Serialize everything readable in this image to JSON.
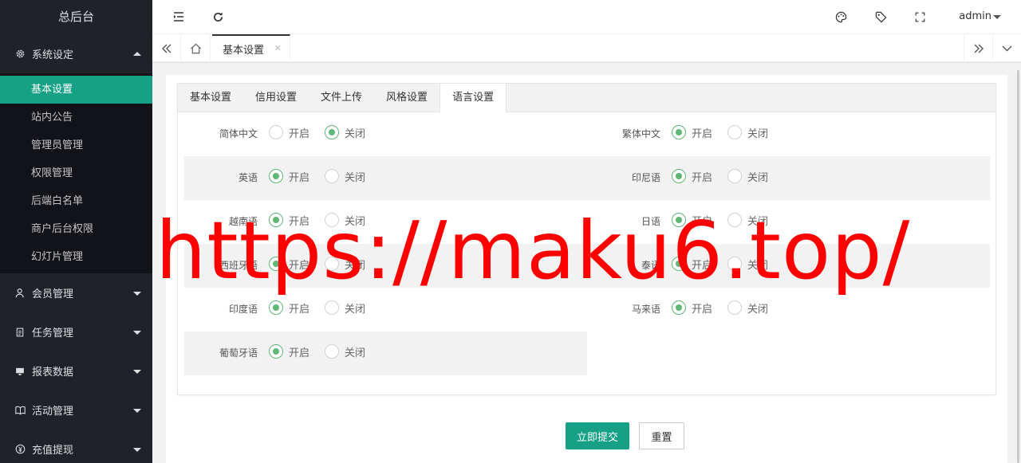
{
  "sidebar": {
    "logo": "总后台",
    "groups": [
      {
        "label": "系统设定",
        "icon": "gear-icon",
        "expanded": true,
        "items": [
          "基本设置",
          "站内公告",
          "管理员管理",
          "权限管理",
          "后端白名单",
          "商户后台权限",
          "幻灯片管理"
        ],
        "active_item": "基本设置"
      },
      {
        "label": "会员管理",
        "icon": "users-icon"
      },
      {
        "label": "任务管理",
        "icon": "document-icon"
      },
      {
        "label": "报表数据",
        "icon": "monitor-icon"
      },
      {
        "label": "活动管理",
        "icon": "book-icon"
      },
      {
        "label": "充值提现",
        "icon": "yen-icon"
      }
    ]
  },
  "header": {
    "icons": [
      "menu-fold-icon",
      "refresh-icon",
      "palette-icon",
      "tag-icon",
      "fullscreen-icon"
    ],
    "user": "admin"
  },
  "tabbar": {
    "current_tab": "基本设置"
  },
  "settings": {
    "tabs": [
      "基本设置",
      "信用设置",
      "文件上传",
      "风格设置",
      "语言设置"
    ],
    "active_tab": "语言设置",
    "on_label": "开启",
    "off_label": "关闭",
    "rows": [
      [
        {
          "label": "简体中文",
          "enabled": false
        },
        {
          "label": "繁体中文",
          "enabled": true
        }
      ],
      [
        {
          "label": "英语",
          "enabled": true
        },
        {
          "label": "印尼语",
          "enabled": true
        }
      ],
      [
        {
          "label": "越南语",
          "enabled": true
        },
        {
          "label": "日语",
          "enabled": true
        }
      ],
      [
        {
          "label": "西班牙语",
          "enabled": true
        },
        {
          "label": "泰语",
          "enabled": true
        }
      ],
      [
        {
          "label": "印度语",
          "enabled": true
        },
        {
          "label": "马来语",
          "enabled": true
        }
      ],
      [
        {
          "label": "葡萄牙语",
          "enabled": true
        }
      ]
    ],
    "submit_label": "立即提交",
    "reset_label": "重置"
  },
  "watermark": "https://maku6.top/",
  "colors": {
    "accent": "#16a085",
    "radio_on": "#5fb878",
    "sidebar_bg": "#20222a",
    "watermark": "#ff0000"
  }
}
